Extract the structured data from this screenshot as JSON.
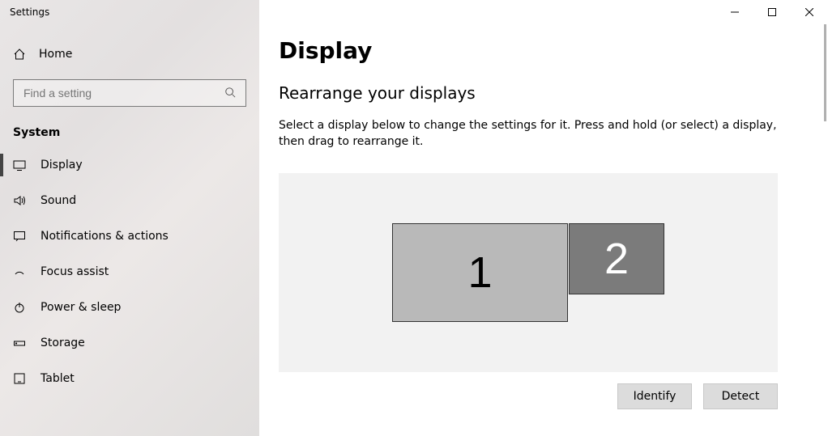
{
  "window": {
    "title": "Settings"
  },
  "sidebar": {
    "home_label": "Home",
    "search_placeholder": "Find a setting",
    "section_label": "System",
    "items": [
      {
        "label": "Display",
        "icon": "display-icon",
        "active": true
      },
      {
        "label": "Sound",
        "icon": "sound-icon"
      },
      {
        "label": "Notifications & actions",
        "icon": "notifications-icon"
      },
      {
        "label": "Focus assist",
        "icon": "focus-assist-icon"
      },
      {
        "label": "Power & sleep",
        "icon": "power-icon"
      },
      {
        "label": "Storage",
        "icon": "storage-icon"
      },
      {
        "label": "Tablet",
        "icon": "tablet-icon"
      }
    ]
  },
  "main": {
    "page_title": "Display",
    "sub_title": "Rearrange your displays",
    "description": "Select a display below to change the settings for it. Press and hold (or select) a display, then drag to rearrange it.",
    "monitors": [
      {
        "label": "1"
      },
      {
        "label": "2"
      }
    ],
    "buttons": {
      "identify": "Identify",
      "detect": "Detect"
    }
  }
}
